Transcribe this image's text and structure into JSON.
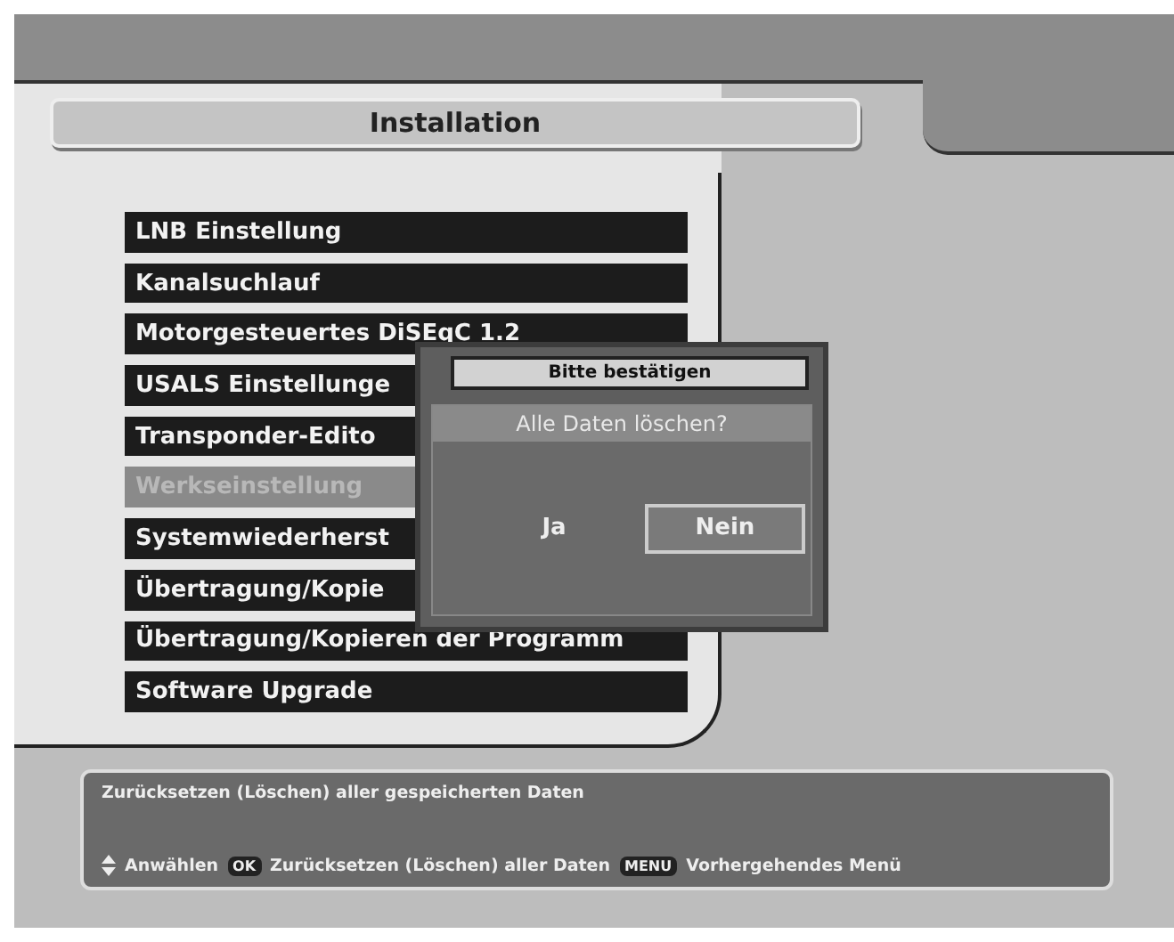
{
  "title": "Installation",
  "menu": [
    {
      "label": "LNB Einstellung",
      "selected": false
    },
    {
      "label": "Kanalsuchlauf",
      "selected": false
    },
    {
      "label": "Motorgesteuertes DiSEqC 1.2",
      "selected": false
    },
    {
      "label": "USALS Einstellunge",
      "selected": false
    },
    {
      "label": "Transponder-Edito",
      "selected": false
    },
    {
      "label": "Werkseinstellung",
      "selected": true
    },
    {
      "label": "Systemwiederherst",
      "selected": false
    },
    {
      "label": "Übertragung/Kopie",
      "selected": false
    },
    {
      "label": "Übertragung/Kopieren der Programm",
      "selected": false
    },
    {
      "label": "Software Upgrade",
      "selected": false
    }
  ],
  "dialog": {
    "title": "Bitte bestätigen",
    "question": "Alle Daten löschen?",
    "buttons": [
      {
        "label": "Ja",
        "selected": false
      },
      {
        "label": "Nein",
        "selected": true
      }
    ]
  },
  "help": {
    "description": "Zurücksetzen (Löschen) aller gespeicherten Daten",
    "hints": [
      {
        "kind": "arrows",
        "label": "Anwählen"
      },
      {
        "kind": "key",
        "key": "OK",
        "label": "Zurücksetzen (Löschen) aller Daten"
      },
      {
        "kind": "key",
        "key": "MENU",
        "label": "Vorhergehendes Menü"
      }
    ]
  }
}
